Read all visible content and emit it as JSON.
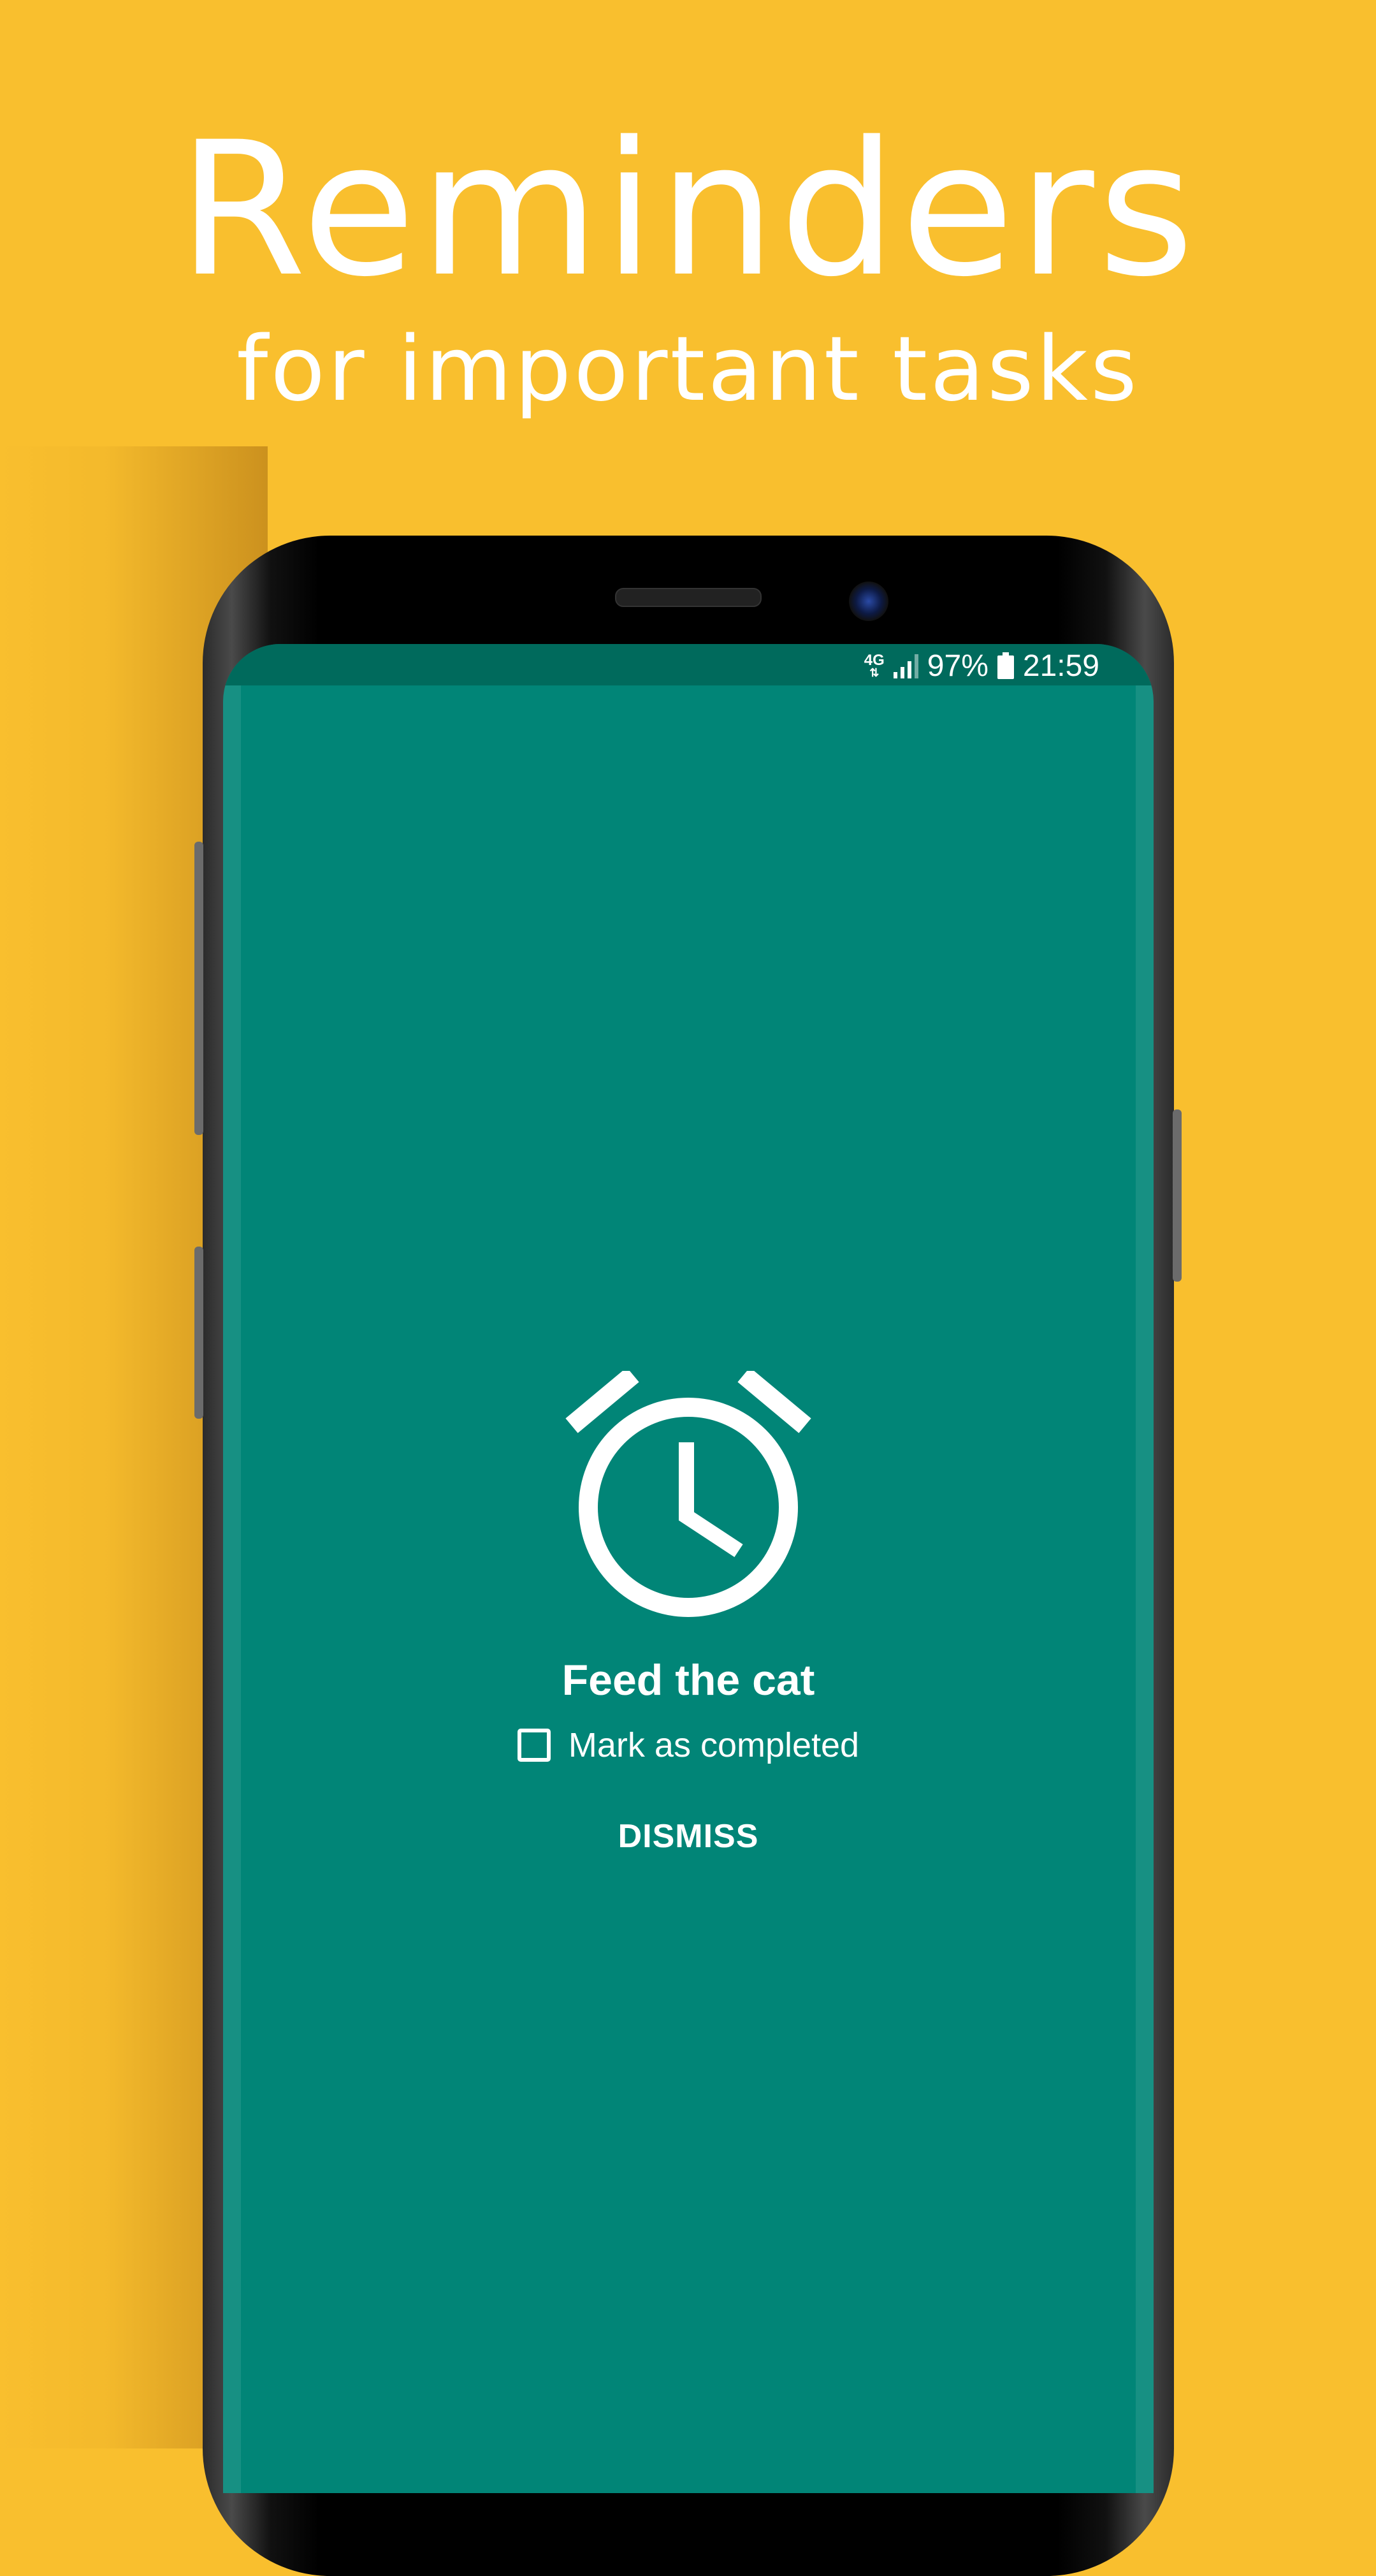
{
  "promo": {
    "title": "Reminders",
    "subtitle": "for important tasks"
  },
  "statusbar": {
    "network": "4G",
    "battery": "97%",
    "time": "21:59"
  },
  "reminder": {
    "icon": "alarm-clock-icon",
    "title": "Feed the cat",
    "checkbox_label": "Mark as completed",
    "checked": false,
    "dismiss_label": "DISMISS"
  },
  "colors": {
    "background": "#F9BF2E",
    "screen": "#018577",
    "statusbar": "#006A5C",
    "foreground": "#FFFFFF"
  }
}
